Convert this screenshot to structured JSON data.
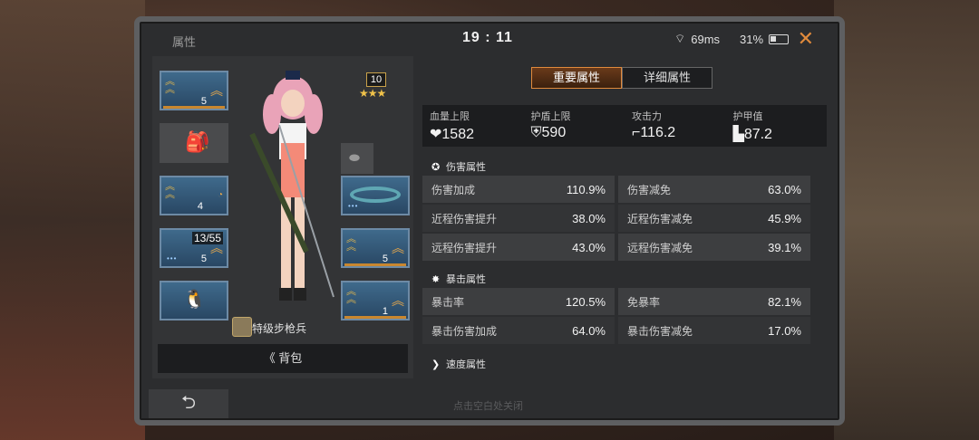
{
  "header": {
    "title": "属性",
    "time": "19 : 11",
    "ping": "69ms",
    "battery": "31%"
  },
  "rank": {
    "level": "10"
  },
  "equipment": {
    "slot1_count": "5",
    "slot3_count": "4",
    "slot4_ammo": "13/55",
    "slot4_count": "5",
    "slot5_count": "5",
    "slot6_count": "1"
  },
  "character": {
    "class_name": "特级步枪兵"
  },
  "bag_button": {
    "label": "《  背包"
  },
  "tabs": [
    {
      "label": "重要属性"
    },
    {
      "label": "详细属性"
    }
  ],
  "main_stats": [
    {
      "label": "血量上限",
      "value": "1582"
    },
    {
      "label": "护盾上限",
      "value": "590"
    },
    {
      "label": "攻击力",
      "value": "116.2"
    },
    {
      "label": "护甲值",
      "value": "87.2"
    }
  ],
  "sections": {
    "damage": {
      "title": "伤害属性",
      "rows": [
        {
          "k1": "伤害加成",
          "v1": "110.9%",
          "k2": "伤害减免",
          "v2": "63.0%"
        },
        {
          "k1": "近程伤害提升",
          "v1": "38.0%",
          "k2": "近程伤害减免",
          "v2": "45.9%"
        },
        {
          "k1": "远程伤害提升",
          "v1": "43.0%",
          "k2": "远程伤害减免",
          "v2": "39.1%"
        }
      ]
    },
    "crit": {
      "title": "暴击属性",
      "rows": [
        {
          "k1": "暴击率",
          "v1": "120.5%",
          "k2": "免暴率",
          "v2": "82.1%"
        },
        {
          "k1": "暴击伤害加成",
          "v1": "64.0%",
          "k2": "暴击伤害减免",
          "v2": "17.0%"
        }
      ]
    },
    "speed": {
      "title": "速度属性"
    }
  },
  "footer": {
    "hint": "点击空白处关闭"
  }
}
